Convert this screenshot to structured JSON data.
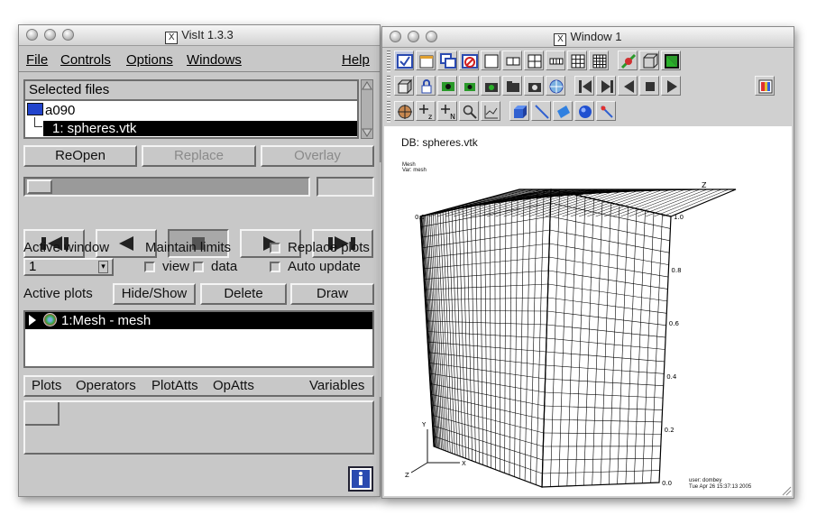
{
  "visit_window": {
    "title": "VisIt 1.3.3",
    "menu": [
      "File",
      "Controls",
      "Options",
      "Windows",
      "Help"
    ],
    "selected_files": {
      "header": "Selected files",
      "host": "a090",
      "file": "1: spheres.vtk"
    },
    "file_buttons": {
      "reopen": "ReOpen",
      "replace": "Replace",
      "overlay": "Overlay"
    },
    "active_window": {
      "label": "Active window",
      "value": "1",
      "maintain_limits": "Maintain limits",
      "view": "view",
      "data": "data",
      "replace_plots": "Replace plots",
      "auto_update": "Auto update"
    },
    "active_plots": {
      "label": "Active plots",
      "hide_show": "Hide/Show",
      "delete": "Delete",
      "draw": "Draw",
      "items": [
        "1:Mesh - mesh"
      ]
    },
    "bottom_menu": [
      "Plots",
      "Operators",
      "PlotAtts",
      "OpAtts",
      "Variables"
    ]
  },
  "vis_window": {
    "title": "Window 1",
    "db_label": "DB: spheres.vtk",
    "legend_title": "Mesh",
    "legend_var": "Var: mesh",
    "user_label": "user: dombey",
    "date_label": "Tue Apr 26 15:37:13 2005",
    "axis": {
      "x": "X",
      "y": "Y",
      "z": "Z"
    },
    "ticks": [
      "0.0",
      "0.2",
      "0.4",
      "0.6",
      "0.8",
      "1.0"
    ]
  },
  "colors": {
    "window_bg": "#c8c8c8",
    "selection": "#000000",
    "mesh_line": "#000000"
  }
}
